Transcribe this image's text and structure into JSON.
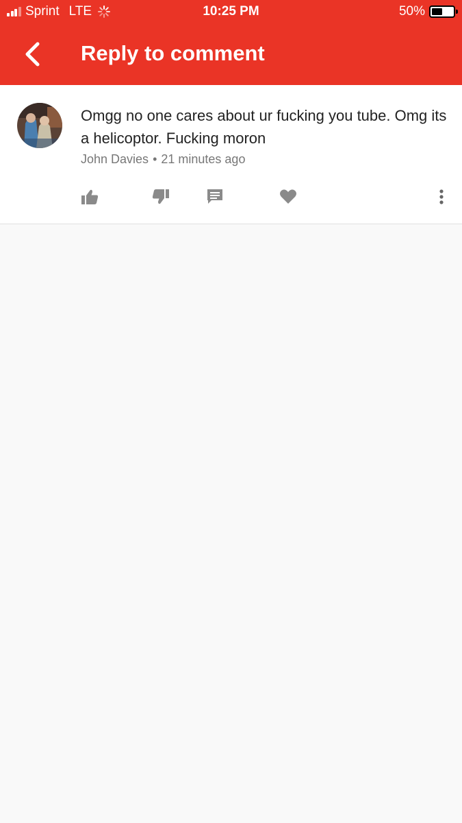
{
  "status_bar": {
    "carrier": "Sprint",
    "network": "LTE",
    "time": "10:25 PM",
    "battery_percent": "50%",
    "battery_level": 0.5,
    "signal_bars": 3
  },
  "app_bar": {
    "back_icon": "chevron-left-icon",
    "title": "Reply to comment",
    "color": "#ea3426"
  },
  "comment": {
    "text": "Omgg no one cares about ur fucking you tube. Omg its a helicoptor. Fucking moron",
    "author": "John Davies",
    "separator": "•",
    "time_ago": "21 minutes ago",
    "actions": [
      {
        "name": "like",
        "icon": "thumb-up-icon"
      },
      {
        "name": "dislike",
        "icon": "thumb-down-icon"
      },
      {
        "name": "reply",
        "icon": "comment-icon"
      },
      {
        "name": "heart",
        "icon": "heart-icon"
      },
      {
        "name": "more",
        "icon": "more-vertical-icon"
      }
    ]
  }
}
